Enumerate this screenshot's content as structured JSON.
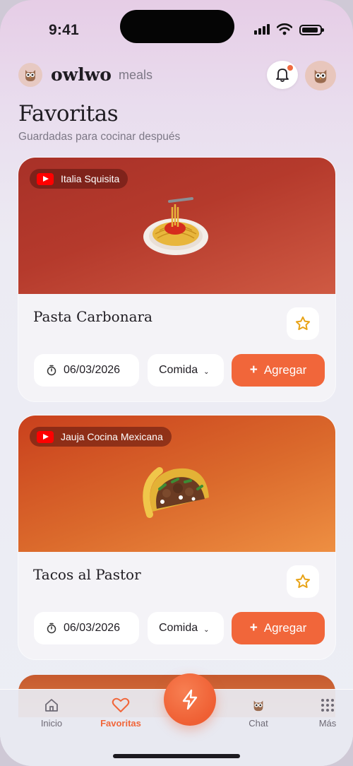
{
  "status": {
    "time": "9:41"
  },
  "header": {
    "brand": "owlwo",
    "brand_sub": "meals"
  },
  "page": {
    "title": "Favoritas",
    "subtitle": "Guardadas para cocinar después"
  },
  "cards": [
    {
      "channel": "Italia Squisita",
      "title": "Pasta Carbonara",
      "date": "06/03/2026",
      "meal": "Comida",
      "add_label": "Agregar",
      "food_icon": "spaghetti-icon"
    },
    {
      "channel": "Jauja Cocina Mexicana",
      "title": "Tacos al Pastor",
      "date": "06/03/2026",
      "meal": "Comida",
      "add_label": "Agregar",
      "food_icon": "taco-icon"
    }
  ],
  "tabs": [
    {
      "label": "Inicio",
      "icon": "home-icon"
    },
    {
      "label": "Favoritas",
      "icon": "heart-icon",
      "active": true
    },
    {
      "label": "Chat",
      "icon": "owl-icon"
    },
    {
      "label": "Más",
      "icon": "grid-icon"
    }
  ],
  "colors": {
    "accent": "#f1663a",
    "star": "#e8a317"
  }
}
